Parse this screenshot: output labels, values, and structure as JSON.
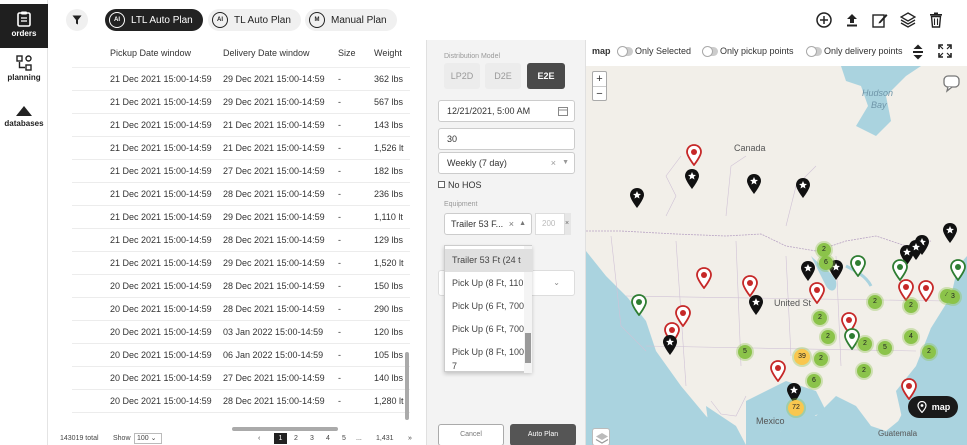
{
  "nav": {
    "orders": "orders",
    "planning": "planning",
    "databases": "databases"
  },
  "toolbar": {
    "ltl_auto_plan": "LTL Auto Plan",
    "tl_auto_plan": "TL Auto Plan",
    "manual_plan": "Manual Plan",
    "ltl_icon": "AI",
    "tl_icon": "AI",
    "manual_icon": "M"
  },
  "table": {
    "headers": {
      "pickup": "Pickup Date window",
      "delivery": "Delivery Date window",
      "size": "Size",
      "weight": "Weight"
    },
    "rows": [
      {
        "pickup": "21 Dec 2021 15:00-14:59",
        "delivery": "29 Dec 2021 15:00-14:59",
        "size": "-",
        "weight": "362 lbs"
      },
      {
        "pickup": "21 Dec 2021 15:00-14:59",
        "delivery": "29 Dec 2021 15:00-14:59",
        "size": "-",
        "weight": "567 lbs"
      },
      {
        "pickup": "21 Dec 2021 15:00-14:59",
        "delivery": "21 Dec 2021 15:00-14:59",
        "size": "-",
        "weight": "143 lbs"
      },
      {
        "pickup": "21 Dec 2021 15:00-14:59",
        "delivery": "21 Dec 2021 15:00-14:59",
        "size": "-",
        "weight": "1,526 lt"
      },
      {
        "pickup": "21 Dec 2021 15:00-14:59",
        "delivery": "27 Dec 2021 15:00-14:59",
        "size": "-",
        "weight": "182 lbs"
      },
      {
        "pickup": "21 Dec 2021 15:00-14:59",
        "delivery": "28 Dec 2021 15:00-14:59",
        "size": "-",
        "weight": "236 lbs"
      },
      {
        "pickup": "21 Dec 2021 15:00-14:59",
        "delivery": "29 Dec 2021 15:00-14:59",
        "size": "-",
        "weight": "1,110 lt"
      },
      {
        "pickup": "21 Dec 2021 15:00-14:59",
        "delivery": "28 Dec 2021 15:00-14:59",
        "size": "-",
        "weight": "129 lbs"
      },
      {
        "pickup": "21 Dec 2021 15:00-14:59",
        "delivery": "29 Dec 2021 15:00-14:59",
        "size": "-",
        "weight": "1,520 lt"
      },
      {
        "pickup": "20 Dec 2021 15:00-14:59",
        "delivery": "28 Dec 2021 15:00-14:59",
        "size": "-",
        "weight": "150 lbs"
      },
      {
        "pickup": "20 Dec 2021 15:00-14:59",
        "delivery": "28 Dec 2021 15:00-14:59",
        "size": "-",
        "weight": "290 lbs"
      },
      {
        "pickup": "20 Dec 2021 15:00-14:59",
        "delivery": "03 Jan 2022 15:00-14:59",
        "size": "-",
        "weight": "120 lbs"
      },
      {
        "pickup": "20 Dec 2021 15:00-14:59",
        "delivery": "06 Jan 2022 15:00-14:59",
        "size": "-",
        "weight": "105 lbs"
      },
      {
        "pickup": "20 Dec 2021 15:00-14:59",
        "delivery": "27 Dec 2021 15:00-14:59",
        "size": "-",
        "weight": "140 lbs"
      },
      {
        "pickup": "20 Dec 2021 15:00-14:59",
        "delivery": "28 Dec 2021 15:00-14:59",
        "size": "-",
        "weight": "1,280 lt"
      }
    ]
  },
  "footer": {
    "total": "143019 total",
    "show_label": "Show",
    "show_value": "100",
    "pages": [
      "1",
      "2",
      "3",
      "4",
      "5",
      "...",
      "1,431"
    ],
    "prev": "‹",
    "next": "»"
  },
  "panel": {
    "distribution_label": "Distribution Model",
    "models": [
      "LP2D",
      "D2E",
      "E2E"
    ],
    "date": "12/21/2021, 5:00 AM",
    "days": "30",
    "schedule": "Weekly (7 day)",
    "no_hos": "No HOS",
    "equipment_label": "Equipment",
    "equipment_value": "Trailer 53 F...",
    "equipment_qty_placeholder": "200",
    "dropdown": [
      "Trailer 53 Ft (24 t",
      "Pick Up (8 Ft, 110",
      "Pick Up (6 Ft, 700",
      "Pick Up (6 Ft, 700",
      "Pick Up (8 Ft, 100",
      "7"
    ],
    "cancel": "Cancel",
    "auto_plan": "Auto Plan"
  },
  "mapbar": {
    "map": "map",
    "only_selected": "Only Selected",
    "only_pickup": "Only pickup points",
    "only_delivery": "Only delivery points"
  },
  "map": {
    "labels": {
      "hudson": "Hudson",
      "bay": "Bay",
      "canada": "Canada",
      "united_states": "United St",
      "mexico": "Mexico",
      "guatemala": "Guatemala"
    },
    "zoom_in": "+",
    "zoom_out": "−",
    "map_button": "map",
    "clusters": [
      "6",
      "2",
      "2",
      "4",
      "2",
      "2",
      "2",
      "5",
      "4",
      "2",
      "39",
      "2",
      "6",
      "5",
      "72",
      "2",
      "3",
      "2"
    ]
  },
  "colors": {
    "land": "#f2efe9",
    "water": "#aad3df",
    "pin_red": "#c62828",
    "pin_green": "#2e7d32",
    "pin_black": "#111111",
    "cluster_green": "#8bc34a",
    "cluster_yellow": "#f9c74f"
  }
}
